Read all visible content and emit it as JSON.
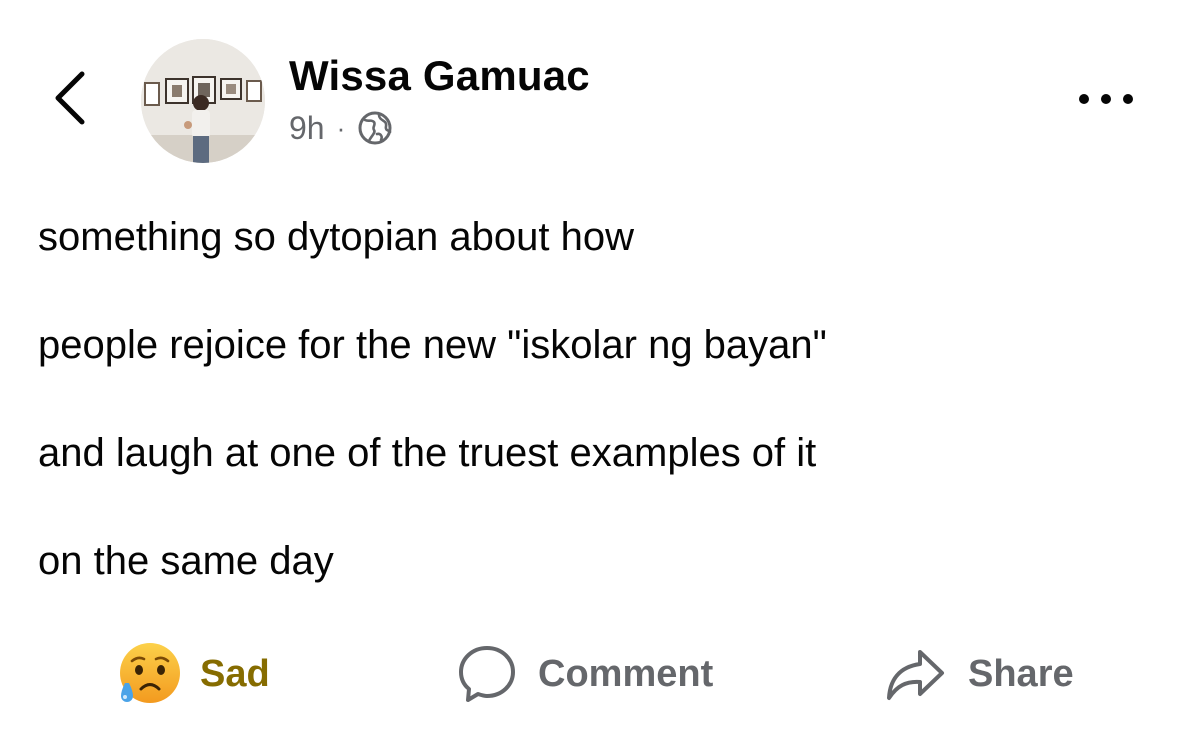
{
  "post": {
    "author_name": "Wissa Gamuac",
    "time": "9h",
    "separator": "·",
    "audience_icon": "globe-icon",
    "lines": [
      "something so dytopian about how",
      "people rejoice for the new \"iskolar ng bayan\"",
      "and laugh at one of the truest examples of it",
      "on the same day"
    ]
  },
  "actions": {
    "reaction_label": "Sad",
    "reaction_icon": "sad-emoji-icon",
    "comment_label": "Comment",
    "share_label": "Share"
  },
  "colors": {
    "text": "#050505",
    "secondary": "#65676b",
    "sad_reaction": "#866c00",
    "emoji_yellow": "#f7b125"
  }
}
